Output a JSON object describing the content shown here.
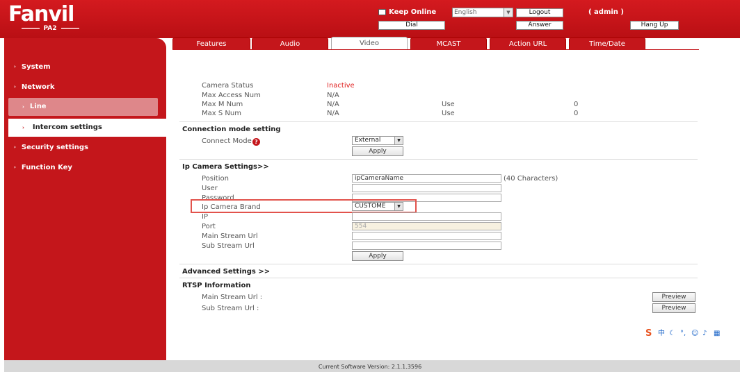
{
  "header": {
    "logo_text": "Fanvil",
    "model": "PA2",
    "keep_online_label": "Keep Online",
    "language_value": "English",
    "logout_label": "Logout",
    "user_label": "( admin )",
    "dial_label": "Dial",
    "answer_label": "Answer",
    "hangup_label": "Hang Up"
  },
  "tabs": [
    {
      "label": "Features"
    },
    {
      "label": "Audio"
    },
    {
      "label": "Video"
    },
    {
      "label": "MCAST"
    },
    {
      "label": "Action URL"
    },
    {
      "label": "Time/Date"
    }
  ],
  "sidebar": {
    "items": [
      {
        "label": "System"
      },
      {
        "label": "Network"
      },
      {
        "label": "Line"
      },
      {
        "label": "Intercom settings"
      },
      {
        "label": "Security settings"
      },
      {
        "label": "Function Key"
      }
    ]
  },
  "camera_status": {
    "status_label": "Camera Status",
    "status_value": "Inactive",
    "max_access_label": "Max Access Num",
    "max_access_value": "N/A",
    "max_m_label": "Max M Num",
    "max_m_value": "N/A",
    "max_m_use_label": "Use",
    "max_m_use_value": "0",
    "max_s_label": "Max S Num",
    "max_s_value": "N/A",
    "max_s_use_label": "Use",
    "max_s_use_value": "0"
  },
  "connection": {
    "title": "Connection mode setting",
    "connect_mode_label": "Connect Mode",
    "connect_mode_value": "External",
    "apply_label": "Apply"
  },
  "ip_camera": {
    "title": "Ip Camera Settings>>",
    "position_label": "Position",
    "position_value": "ipCameraName",
    "position_hint": "(40 Characters)",
    "user_label": "User",
    "password_label": "Password",
    "brand_label": "Ip Camera Brand",
    "brand_value": "CUSTOME",
    "ip_label": "IP",
    "port_label": "Port",
    "port_value": "554",
    "main_stream_label": "Main Stream Url",
    "sub_stream_label": "Sub Stream Url",
    "apply_label": "Apply"
  },
  "advanced": {
    "title": "Advanced Settings >>"
  },
  "rtsp": {
    "title": "RTSP Information",
    "main_label": "Main Stream Url :",
    "sub_label": "Sub Stream Url :",
    "preview_label": "Preview"
  },
  "footer": {
    "version": "Current Software Version: 2.1.1.3596"
  },
  "colors": {
    "brand_red": "#c4161b",
    "status_inactive": "#e0201f"
  }
}
